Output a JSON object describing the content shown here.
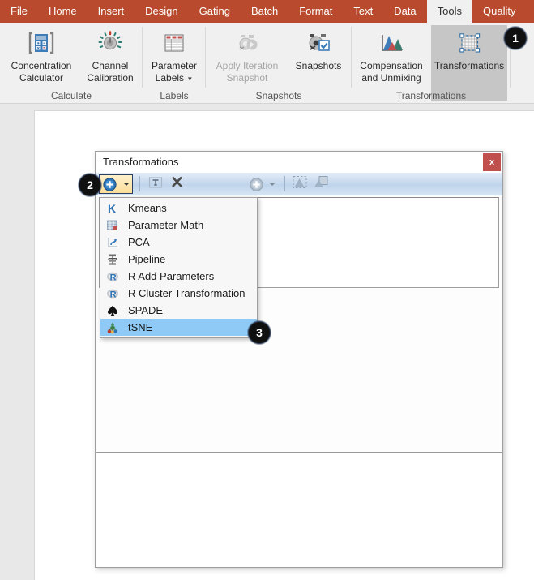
{
  "ribbon": {
    "tabs": [
      {
        "label": "File",
        "active": false
      },
      {
        "label": "Home",
        "active": false
      },
      {
        "label": "Insert",
        "active": false
      },
      {
        "label": "Design",
        "active": false
      },
      {
        "label": "Gating",
        "active": false
      },
      {
        "label": "Batch",
        "active": false
      },
      {
        "label": "Format",
        "active": false
      },
      {
        "label": "Text",
        "active": false
      },
      {
        "label": "Data",
        "active": false
      },
      {
        "label": "Tools",
        "active": true
      },
      {
        "label": "Quality",
        "active": false
      }
    ],
    "accent_color": "#B94A2D",
    "groups": [
      {
        "name": "Calculate",
        "label": "Calculate",
        "buttons": [
          {
            "line1": "Concentration",
            "line2": "Calculator",
            "icon": "calculator-icon",
            "disabled": false,
            "selected": false
          },
          {
            "line1": "Channel",
            "line2": "Calibration",
            "icon": "dial-icon",
            "disabled": false,
            "selected": false
          }
        ]
      },
      {
        "name": "Labels",
        "label": "Labels",
        "buttons": [
          {
            "line1": "Parameter",
            "line2": "Labels",
            "icon": "table-labels-icon",
            "disabled": false,
            "selected": false,
            "has_caret": true
          }
        ]
      },
      {
        "name": "Snapshots",
        "label": "Snapshots",
        "buttons": [
          {
            "line1": "Apply Iteration",
            "line2": "Snapshot",
            "icon": "apply-iteration-icon",
            "disabled": true,
            "selected": false
          },
          {
            "line1": "Snapshots",
            "line2": "",
            "icon": "snapshots-icon",
            "disabled": false,
            "selected": false
          }
        ]
      },
      {
        "name": "Transformations",
        "label": "Transformations",
        "buttons": [
          {
            "line1": "Compensation",
            "line2": "and Unmixing",
            "icon": "compensation-icon",
            "disabled": false,
            "selected": false
          },
          {
            "line1": "Transformations",
            "line2": "",
            "icon": "transformations-icon",
            "disabled": false,
            "selected": true
          }
        ]
      }
    ]
  },
  "dialog": {
    "title": "Transformations",
    "close_label": "x",
    "toolbar": {
      "add_button": "add-transformation-button",
      "add_caret": "add-dropdown-caret",
      "rename_button": "rename-button",
      "delete_button": "delete-button",
      "add_param_button": "add-parameter-button",
      "add_param_caret": "add-parameter-caret",
      "apply_button": "apply-to-selection-button",
      "copy_button": "copy-to-button"
    }
  },
  "menu": {
    "name": "add-transformation-menu",
    "items": [
      {
        "label": "Kmeans",
        "icon": "kmeans-icon",
        "highlighted": false
      },
      {
        "label": "Parameter Math",
        "icon": "parameter-math-icon",
        "highlighted": false
      },
      {
        "label": "PCA",
        "icon": "pca-icon",
        "highlighted": false
      },
      {
        "label": "Pipeline",
        "icon": "pipeline-icon",
        "highlighted": false
      },
      {
        "label": "R Add Parameters",
        "icon": "r-add-parameters-icon",
        "highlighted": false
      },
      {
        "label": "R Cluster Transformation",
        "icon": "r-cluster-transformation-icon",
        "highlighted": false
      },
      {
        "label": "SPADE",
        "icon": "spade-icon",
        "highlighted": false
      },
      {
        "label": "tSNE",
        "icon": "tsne-icon",
        "highlighted": true
      }
    ],
    "highlight_color": "#8ECAF5"
  },
  "badges": [
    {
      "number": "1",
      "target": "transformations-ribbon-button"
    },
    {
      "number": "2",
      "target": "add-transformation-button"
    },
    {
      "number": "3",
      "target": "menu-item-tsne"
    }
  ]
}
